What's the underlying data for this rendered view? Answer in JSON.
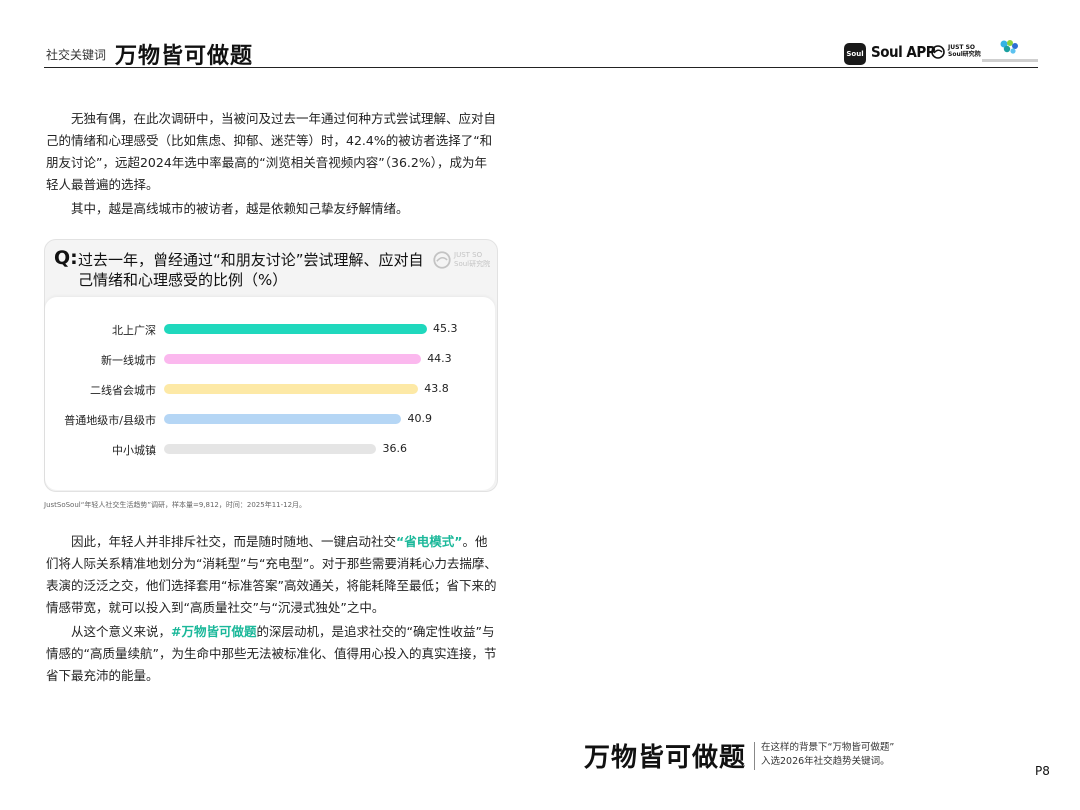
{
  "header": {
    "label": "社交关键词",
    "title": "万物皆可做题",
    "logo_soul_mark": "Soul",
    "logo_app": "Soul APP",
    "logo_js_line1": "JUST SO",
    "logo_js_line2": "Soul研究院"
  },
  "paragraphs": {
    "p1": "无独有偶，在此次调研中，当被问及过去一年通过何种方式尝试理解、应对自己的情绪和心理感受（比如焦虑、抑郁、迷茫等）时，42.4%的被访者选择了“和朋友讨论”，远超2024年选中率最高的“浏览相关音视频内容”（36.2%），成为年轻人最普遍的选择。",
    "p2": "其中，越是高线城市的被访者，越是依赖知己挚友纾解情绪。",
    "p3_before": "因此，年轻人并非排斥社交，而是随时随地、一键启动社交",
    "p3_highlight": "“省电模式”",
    "p3_after": "。他们将人际关系精准地划分为“消耗型”与“充电型”。对于那些需要消耗心力去揣摩、表演的泛泛之交，他们选择套用“标准答案”高效通关，将能耗降至最低；省下来的情感带宽，就可以投入到“高质量社交”与“沉浸式独处”之中。",
    "p4_before": "从这个意义来说，",
    "p4_highlight": "#万物皆可做题",
    "p4_after": "的深层动机，是追求社交的“确定性收益”与情感的“高质量续航”，为生命中那些无法被标准化、值得用心投入的真实连接，节省下最充沛的能量。"
  },
  "chart_card": {
    "q_mark": "Q:",
    "question": "过去一年，曾经通过“和朋友讨论”尝试理解、应对自己情绪和心理感受的比例（%）",
    "logo_line1": "JUST SO",
    "logo_line2": "Soul研究院"
  },
  "chart_data": {
    "type": "bar",
    "orientation": "horizontal",
    "title": "过去一年，曾经通过“和朋友讨论”尝试理解、应对自己情绪和心理感受的比例（%）",
    "categories": [
      "北上广深",
      "新一线城市",
      "二线省会城市",
      "普通地级市/县级市",
      "中小城镇"
    ],
    "values": [
      45.3,
      44.3,
      43.8,
      40.9,
      36.6
    ],
    "colors": [
      "#1fd8bd",
      "#fbb8ee",
      "#fde9a6",
      "#b5d6f5",
      "#e5e5e5"
    ],
    "xlim": [
      0,
      45.3
    ],
    "grid": false,
    "legend": "none"
  },
  "source": "JustSoSoul“年轻人社交生活趋势”调研，样本量=9,812，时间：2025年11-12月。",
  "footer": {
    "title": "万物皆可做题",
    "note_line1": "在这样的背景下“万物皆可做题”",
    "note_line2": "入选2026年社交趋势关键词。",
    "page": "P8"
  }
}
